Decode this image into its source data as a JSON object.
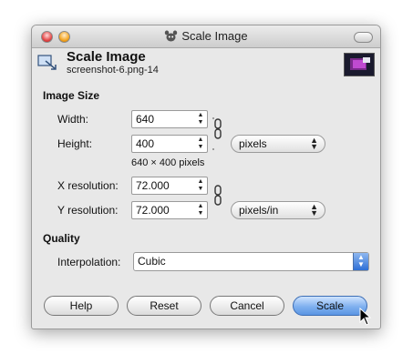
{
  "window": {
    "title": "Scale Image"
  },
  "header": {
    "title": "Scale Image",
    "subtitle": "screenshot-6.png-14"
  },
  "image_size": {
    "section_label": "Image Size",
    "width_label": "Width:",
    "width_value": "640",
    "height_label": "Height:",
    "height_value": "400",
    "unit_select": "pixels",
    "size_note": "640 × 400 pixels",
    "x_res_label": "X resolution:",
    "x_res_value": "72.000",
    "y_res_label": "Y resolution:",
    "y_res_value": "72.000",
    "res_unit_select": "pixels/in"
  },
  "quality": {
    "section_label": "Quality",
    "interp_label": "Interpolation:",
    "interp_value": "Cubic"
  },
  "buttons": {
    "help": "Help",
    "reset": "Reset",
    "cancel": "Cancel",
    "scale": "Scale"
  },
  "colors": {
    "default_button": "#7fb0ef",
    "combo_button": "#2d6fd6"
  }
}
